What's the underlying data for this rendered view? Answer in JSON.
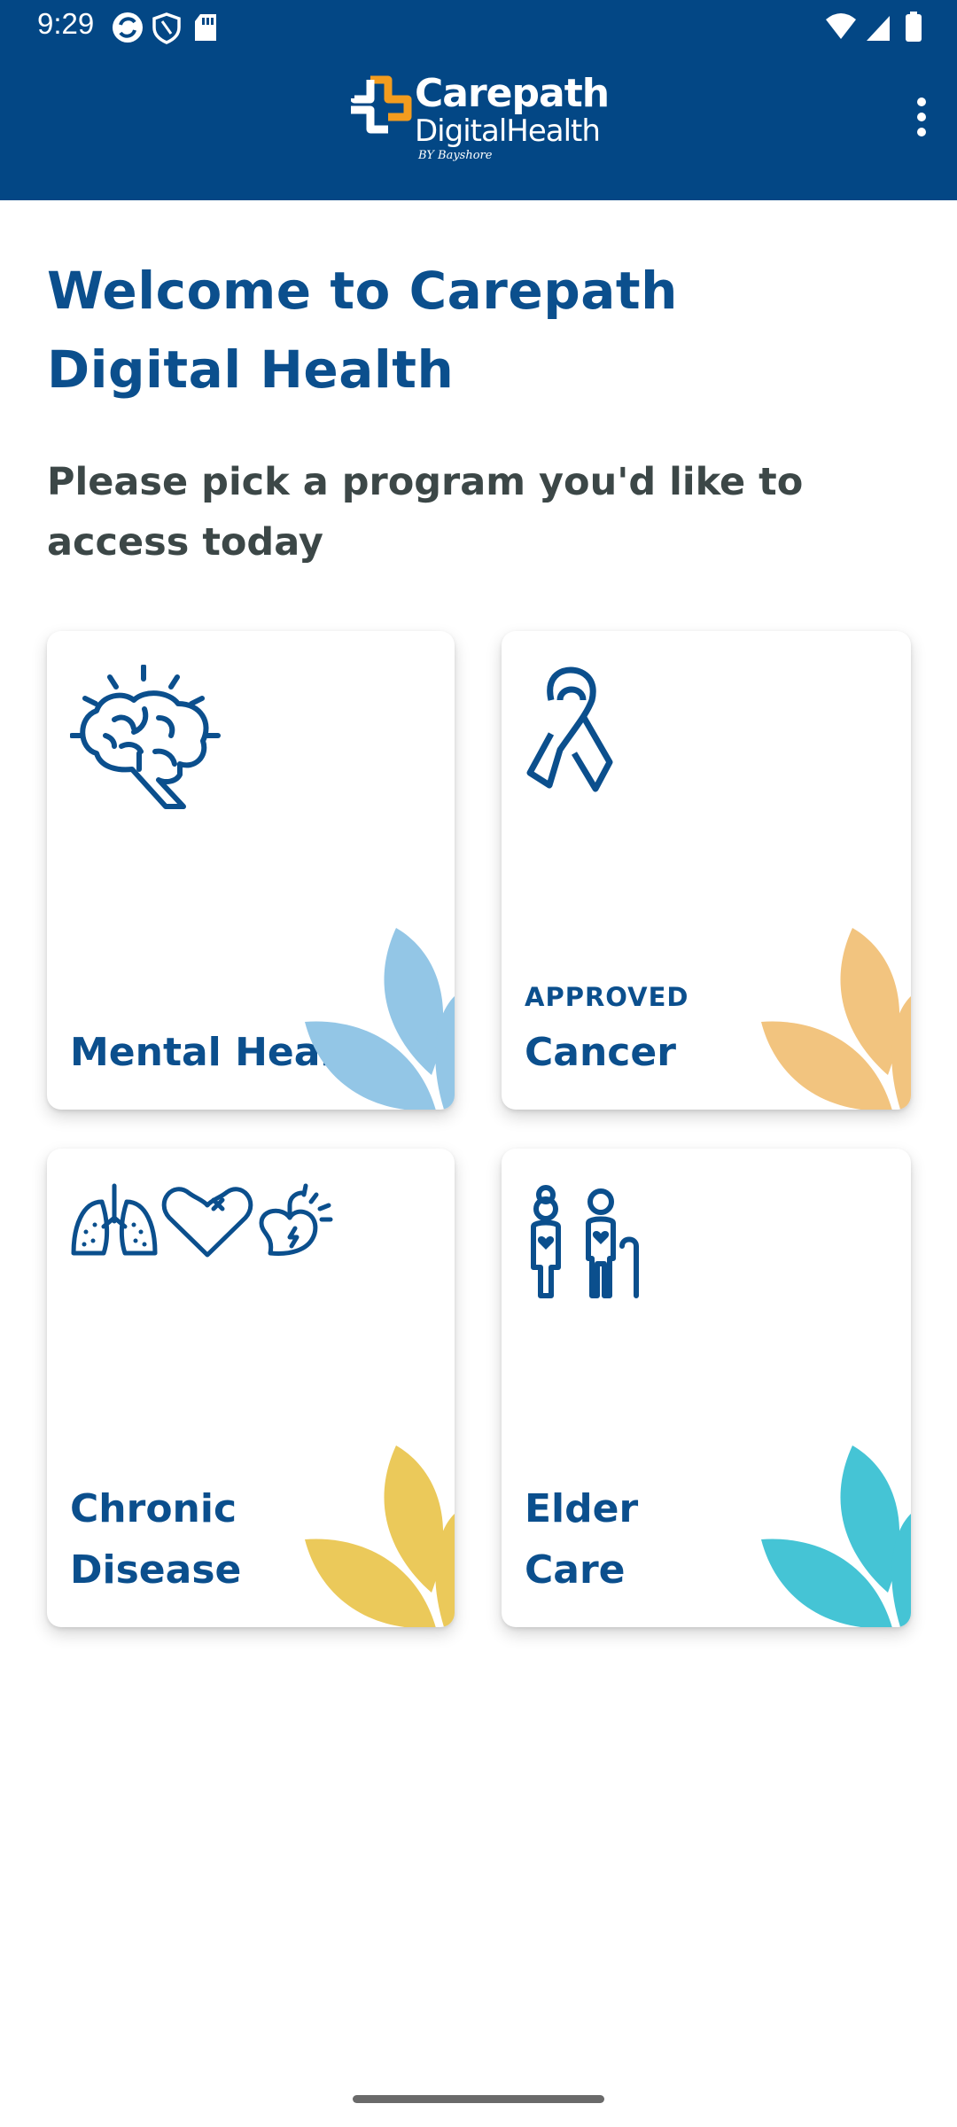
{
  "status_bar": {
    "time": "9:29"
  },
  "header": {
    "logo_line1": "Carepath",
    "logo_line2": "DigitalHealth",
    "logo_line3": "BY Bayshore",
    "menu_icon": "more-vert-icon"
  },
  "main": {
    "title": "Welcome to Carepath Digital Health",
    "subtitle": "Please pick a program you'd like to access today"
  },
  "programs": [
    {
      "label": "Mental Health",
      "icon": "brain-icon",
      "accent": "#93c6e6"
    },
    {
      "label": "Cancer",
      "badge": "APPROVED",
      "icon": "ribbon-icon",
      "accent": "#f2c47f"
    },
    {
      "label": "Chronic Disease",
      "icon": "organs-icon",
      "accent": "#ebc95a"
    },
    {
      "label": "Elder Care",
      "icon": "elderly-couple-icon",
      "accent": "#45c4d5"
    }
  ],
  "colors": {
    "header_bg": "#034785",
    "title_blue": "#0b4f8d",
    "subtitle_gray": "#3c4747",
    "logo_orange": "#f39c1e"
  }
}
